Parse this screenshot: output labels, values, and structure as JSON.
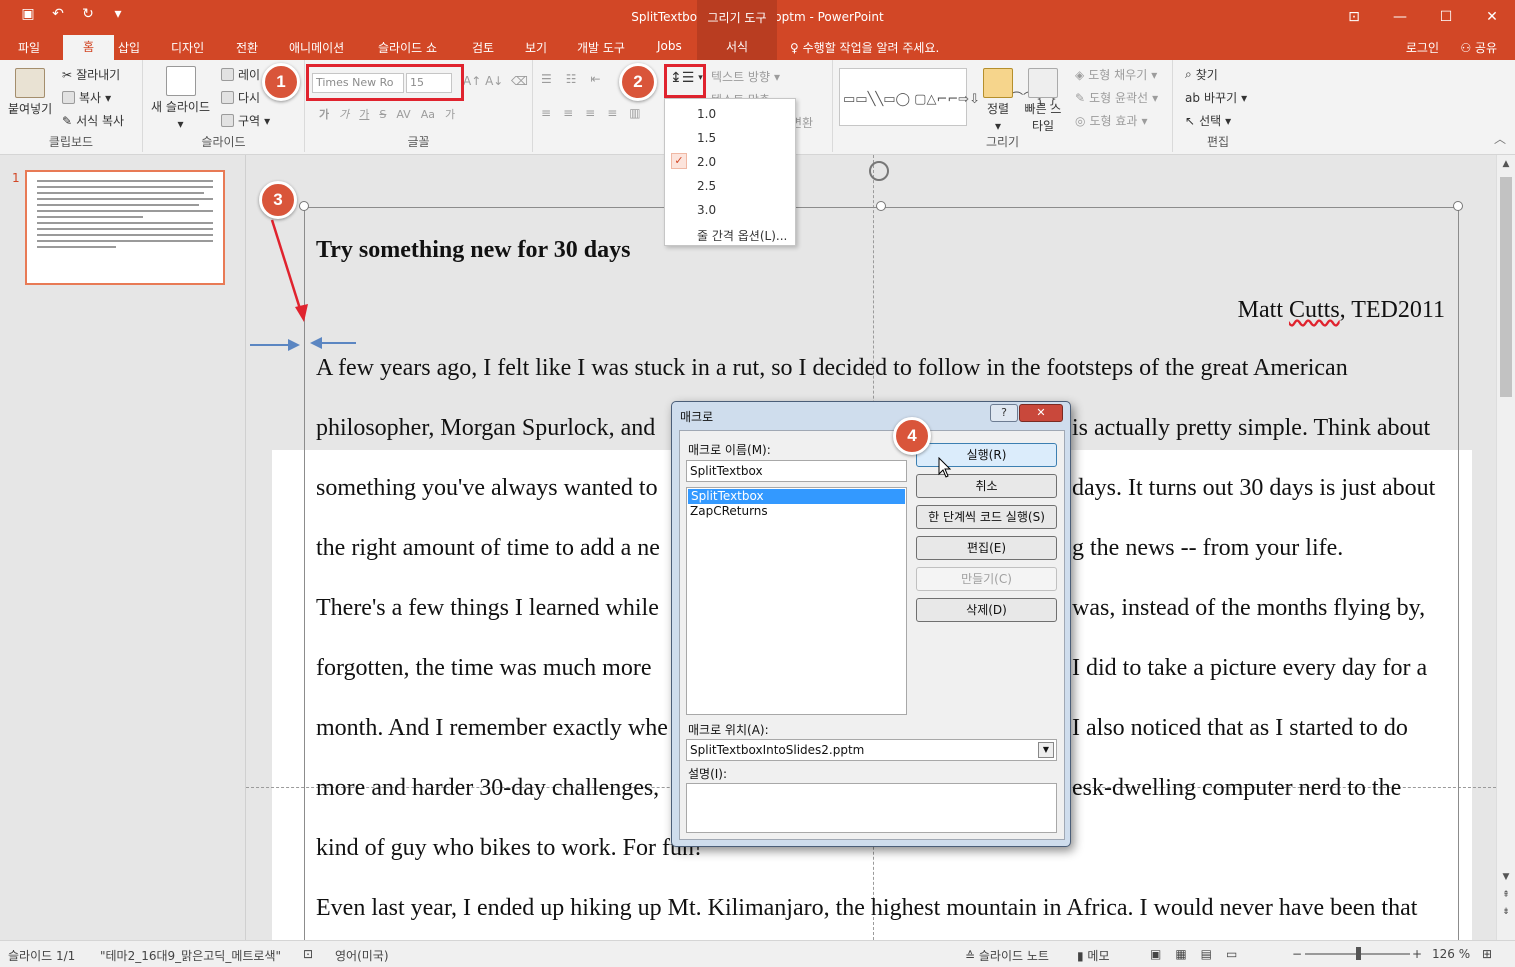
{
  "titlebar": {
    "doc_title": "SplitTextboxIntoSlides2.pptm - PowerPoint",
    "context_group": "그리기 도구",
    "qat_icons": [
      "save-icon",
      "undo-icon",
      "redo-icon"
    ]
  },
  "tabs": [
    "파일",
    "홈",
    "삽입",
    "디자인",
    "전환",
    "애니메이션",
    "슬라이드 쇼",
    "검토",
    "보기",
    "개발 도구",
    "Jobs",
    "서식"
  ],
  "tell_me": "수행할 작업을 알려 주세요.",
  "login": "로그인",
  "share": "공유",
  "ribbon": {
    "clipboard": {
      "paste": "붙여넣기",
      "cut": "잘라내기",
      "copy": "복사",
      "format_painter": "서식 복사",
      "label": "클립보드"
    },
    "slides": {
      "new_slide": "새 슬라이드",
      "layout": "레이",
      "reset": "다시",
      "section": "구역",
      "label": "슬라이드"
    },
    "font": {
      "font_name": "Times New Ro",
      "font_size": "15",
      "label": "글꼴",
      "bold": "가",
      "italic": "가",
      "underline": "가",
      "strike": "S",
      "aa": "Aa",
      "clear": "가"
    },
    "paragraph": {
      "text_direction": "텍스트 방향",
      "align_text": "텍스트 맞춤",
      "convert": "변환"
    },
    "drawing": {
      "arrange": "정렬",
      "quick_styles": "빠른 스타일",
      "fill": "도형 채우기",
      "outline": "도형 윤곽선",
      "effects": "도형 효과",
      "label": "그리기"
    },
    "editing": {
      "find": "찾기",
      "replace": "바꾸기",
      "select": "선택",
      "label": "편집"
    }
  },
  "line_spacing_menu": {
    "items": [
      "1.0",
      "1.5",
      "2.0",
      "2.5",
      "3.0"
    ],
    "selected": "2.0",
    "options": "줄 간격 옵션(L)..."
  },
  "callouts": [
    "1",
    "2",
    "3",
    "4"
  ],
  "thumbnail": {
    "number": "1"
  },
  "slide": {
    "title": "Try something new for 30 days",
    "author_name": "Matt ",
    "author_underlined": "Cutts",
    "author_rest": ", TED2011",
    "lines": [
      "A few years ago, I felt like I was stuck in a rut, so I decided to follow in the footsteps of the great American",
      "philosopher, Morgan Spurlock, and",
      "something you've always wanted to",
      "the right amount of time to add a ne",
      "There's a few things I learned while",
      "forgotten, the time was much more",
      "month. And I remember exactly whe",
      "more and harder 30-day challenges,",
      "kind of guy who bikes to work. For fun!",
      "Even last year, I ended up hiking up Mt. Kilimanjaro, the highest mountain in Africa. I would never have been that"
    ],
    "right_lines": [
      "is actually pretty simple. Think about",
      "days. It turns out 30 days is just about",
      "g the news -- from your life.",
      "was, instead of the months flying by,",
      "I did to take a picture every day for a",
      "I also noticed that as I started to do",
      "esk-dwelling computer nerd to the"
    ]
  },
  "dialog": {
    "title": "매크로",
    "help": "?",
    "name_label": "매크로 이름(M):",
    "name_value": "SplitTextbox",
    "macros": [
      "SplitTextbox",
      "ZapCReturns"
    ],
    "selected_macro": "SplitTextbox",
    "buttons": {
      "run": "실행(R)",
      "cancel": "취소",
      "step": "한 단계씩 코드 실행(S)",
      "edit": "편집(E)",
      "create": "만들기(C)",
      "delete": "삭제(D)"
    },
    "location_label": "매크로 위치(A):",
    "location_value": "SplitTextboxIntoSlides2.pptm",
    "desc_label": "설명(I):"
  },
  "statusbar": {
    "slide_pos": "슬라이드 1/1",
    "theme": "\"테마2_16대9_맑은고딕_메트로색\"",
    "language": "영어(미국)",
    "notes": "슬라이드 노트",
    "comments": "메모",
    "zoom": "126 %"
  },
  "colors": {
    "accent": "#d24726",
    "callout": "#d9553a",
    "highlight_box": "#e0232e"
  }
}
